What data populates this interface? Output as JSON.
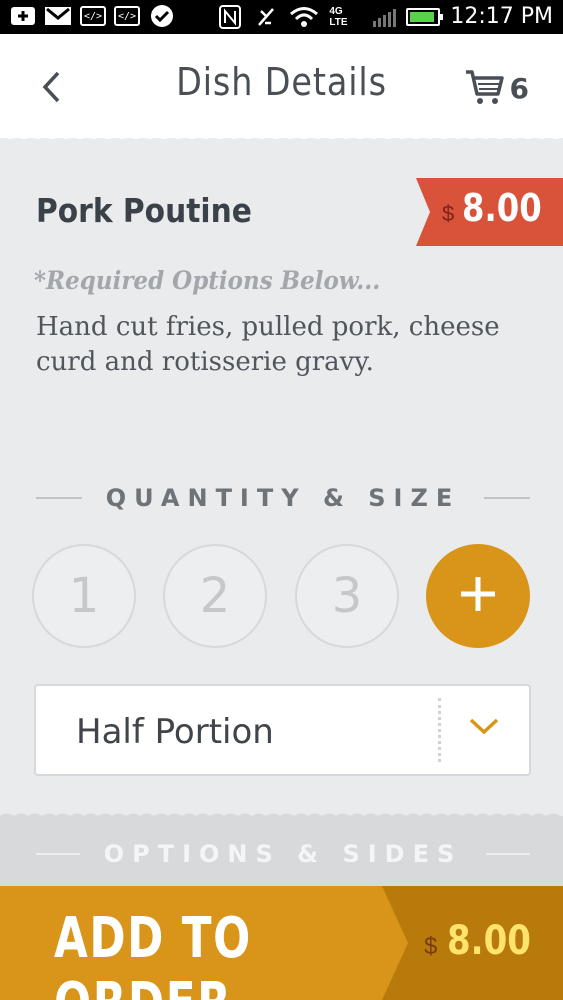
{
  "status_bar": {
    "time": "12:17 PM",
    "network": "4G LTE",
    "icons": [
      "add-icon",
      "gmail-icon",
      "code-icon",
      "code-icon",
      "check-icon",
      "nfc-icon",
      "mute-icon",
      "wifi-icon",
      "signal-icon",
      "battery-icon"
    ]
  },
  "header": {
    "title": "Dish Details",
    "cart_count": "6"
  },
  "dish": {
    "name": "Pork Poutine",
    "price_symbol": "$",
    "price": "8.00",
    "required_note": "*Required Options Below...",
    "description": "Hand cut fries, pulled pork, cheese curd and rotisserie gravy."
  },
  "quantity": {
    "title": "QUANTITY & SIZE",
    "options": [
      "1",
      "2",
      "3"
    ]
  },
  "size": {
    "selected": "Half Portion"
  },
  "options": {
    "title": "OPTIONS & SIDES"
  },
  "footer": {
    "add_label": "ADD TO ORDER",
    "price_symbol": "$",
    "price": "8.00"
  },
  "colors": {
    "accent": "#d9951a",
    "price_tag": "#d9533b",
    "footer_dark": "#b77a0b",
    "text_dark": "#3b4148"
  }
}
